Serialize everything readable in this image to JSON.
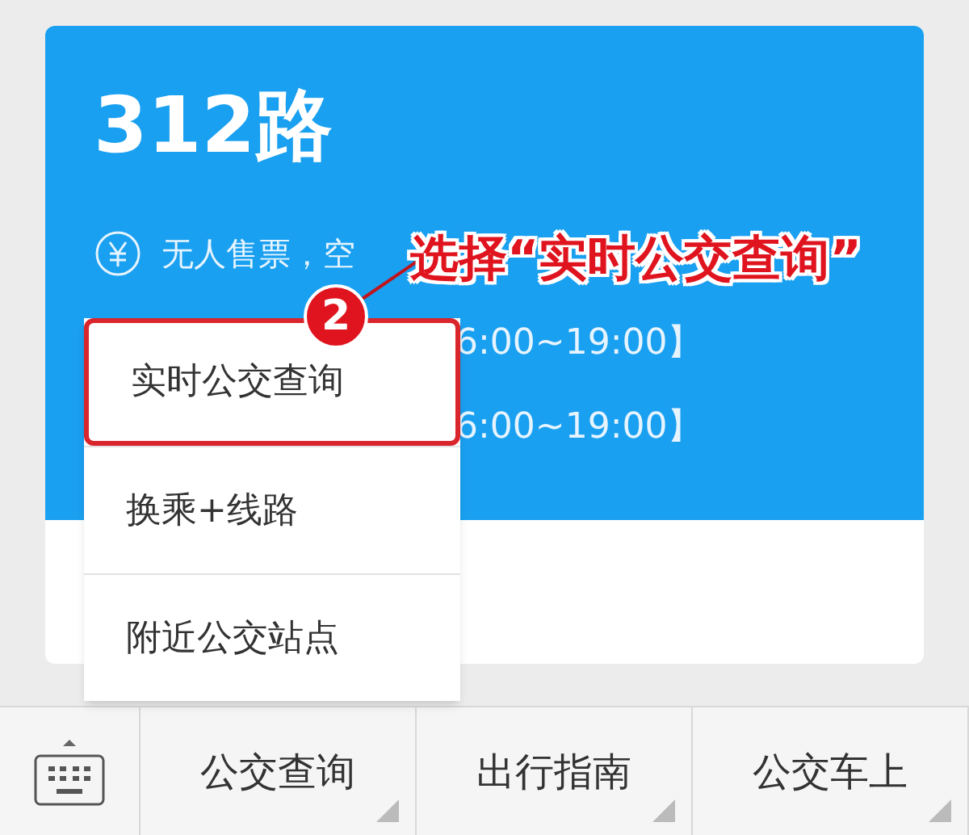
{
  "route": {
    "title": "312路",
    "fare": "无人售票，空",
    "schedules": [
      "6:00~19:00】",
      "6:00~19:00】"
    ]
  },
  "menu": {
    "items": [
      {
        "label": "实时公交查询",
        "selected": true
      },
      {
        "label": "换乘+线路",
        "selected": false
      },
      {
        "label": "附近公交站点",
        "selected": false
      }
    ]
  },
  "annotation": {
    "step": "2",
    "text": "选择“实时公交查询”"
  },
  "bottom_bar": {
    "tabs": [
      {
        "label": "公交查询"
      },
      {
        "label": "出行指南"
      },
      {
        "label": "公交车上"
      }
    ]
  }
}
